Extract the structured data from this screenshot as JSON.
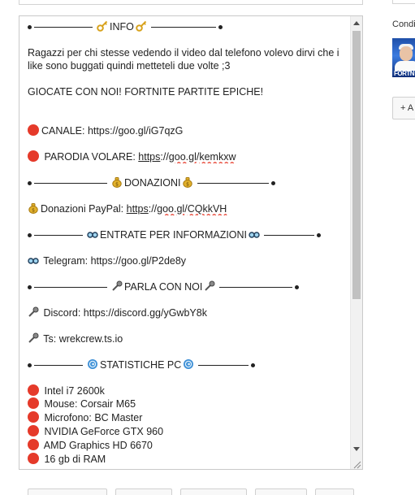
{
  "description_lines": {
    "info_header": "INFO",
    "intro_1": "Ragazzi per chi stesse vedendo il video dal telefono volevo dirvi che i like sono buggati quindi metteteli due volte ;3",
    "intro_2": "GIOCATE CON NOI! FORTNITE PARTITE EPICHE!",
    "canale": "CANALE: https://goo.gl/iG7qzG",
    "parodia_prefix": "PARODIA VOLARE: ",
    "parodia_link_a": "https",
    "parodia_link_b": "://",
    "parodia_link_c": "goo.gl",
    "parodia_link_d": "/",
    "parodia_link_e": "kemkxw",
    "donazioni_header": "DONAZIONI",
    "paypal_prefix": "Donazioni PayPal: ",
    "paypal_link_a": "https",
    "paypal_link_b": "://",
    "paypal_link_c": "goo.gl",
    "paypal_link_d": "/",
    "paypal_link_e": "CQkkVH",
    "entrate_header": "ENTRATE PER INFORMAZIONI",
    "telegram": "Telegram: https://goo.gl/P2de8y",
    "parla_header": "PARLA CON NOI",
    "discord": "Discord: https://discord.gg/yGwbY8k",
    "ts": "Ts: wrekcrew.ts.io",
    "stat_header": "STATISTICHE PC",
    "specs": [
      "Intel i7 2600k",
      "Mouse: Corsair M65",
      "Microfono: BC Master",
      "NVIDIA GeForce GTX 960",
      "AMD Graphics HD 6670",
      "16 gb di RAM"
    ]
  },
  "sidebar": {
    "label": "Condi",
    "thumb_text": "FORTN",
    "add_button": "+ A"
  },
  "colors": {
    "red_circle": "#e53a2a",
    "scroll_thumb": "#c1c1c1"
  }
}
